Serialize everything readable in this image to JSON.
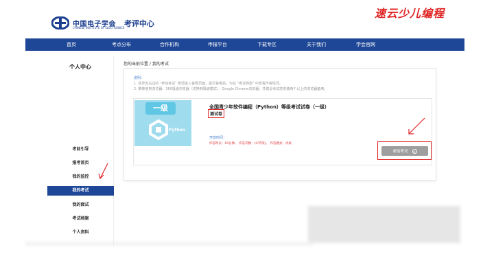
{
  "header": {
    "logo_title": "中国电子学会",
    "logo_subtitle": "CHINESE INSTITUTE OF ELECTRONICS",
    "logo_suffix": "考评中心",
    "watermark": "速云少儿编程"
  },
  "nav": {
    "items": [
      "首页",
      "考点分布",
      "合作机构",
      "申报平台",
      "下载专区",
      "关于我们",
      "学会官网"
    ]
  },
  "sidebar": {
    "title": "个人中心",
    "items": [
      {
        "label": "考前引导",
        "active": false
      },
      {
        "label": "报考首页",
        "active": false
      },
      {
        "label": "我的监控",
        "active": false
      },
      {
        "label": "我的考试",
        "active": true
      },
      {
        "label": "我的面试",
        "active": false
      },
      {
        "label": "考试档案",
        "active": false
      },
      {
        "label": "个人资料",
        "active": false
      }
    ]
  },
  "breadcrumb": "您的当前位置 / 我的考试",
  "notice": {
    "title": "说明：",
    "lines": [
      "1. 请单击右边的 \"参加考试\" 按钮进入答题页面，提交答卷后，可在 \"考试档案\" 中查看作答情况。",
      "2. 推荐使用浏览器：360极速浏览器（切换到极速模式）、Google Chrome浏览器，并建议考试前安装两个以上的浏览器备用。"
    ]
  },
  "exam": {
    "thumb_level": "一级",
    "thumb_label": "Python",
    "title": "全国青少年软件编程（Python）等级考试试卷（一级）",
    "tag": "测试卷",
    "meta_label": "开放时间：",
    "meta": "作答时长：60分钟， 作答次数：(0/不限)， 作答模式：闭关",
    "join_label": "参加考试"
  },
  "colors": {
    "nav_bg": "#1e4797",
    "active_bg": "#1e4797",
    "highlight_red": "#e02424",
    "thumb_bg": "#9fdcee"
  }
}
